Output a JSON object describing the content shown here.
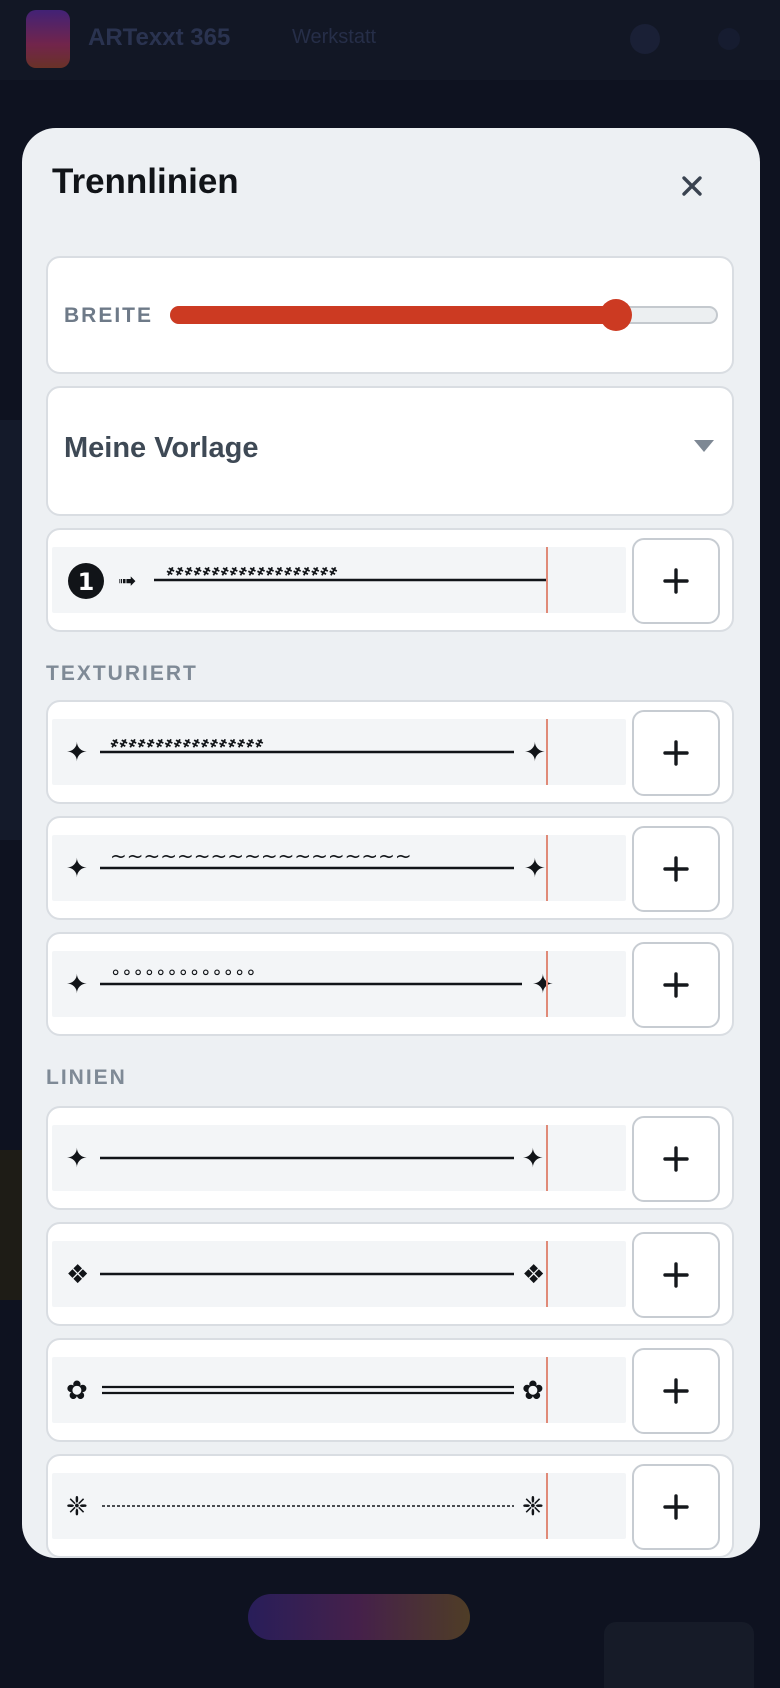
{
  "background": {
    "brand": "ARTexxt 365",
    "nav_item": "Werkstatt"
  },
  "modal": {
    "title": "Trennlinien",
    "close_icon": "close-icon"
  },
  "width_slider": {
    "label": "BREITE",
    "value_fraction": 0.81
  },
  "template_select": {
    "selected": "Meine Vorlage",
    "caret_icon": "caret-down-icon"
  },
  "template_row": {
    "start": "❶",
    "arrow": "➟",
    "texture": "҂҂҂҂҂҂҂҂҂҂҂҂҂҂҂҂҂҂҂",
    "end": ""
  },
  "sections": [
    {
      "label": "TEXTURIERT",
      "rows": [
        {
          "start": "✦",
          "texture": "҂҂҂҂҂҂҂҂҂҂҂҂҂҂҂҂҂",
          "end": "✦"
        },
        {
          "start": "✦",
          "texture": "~~~~~~~~~~~~~~~~~~",
          "end": "✦"
        },
        {
          "start": "✦",
          "texture": "∘∘∘∘∘∘∘∘∘∘∘∘∘",
          "end": "✦"
        }
      ]
    },
    {
      "label": "LINIEN",
      "rows": [
        {
          "start": "✦",
          "style": "solid",
          "end": "✦"
        },
        {
          "start": "❖",
          "style": "solid",
          "end": "❖"
        },
        {
          "start": "✿",
          "style": "double",
          "end": "✿"
        },
        {
          "start": "❈",
          "style": "dashed",
          "end": "❈"
        }
      ]
    }
  ],
  "add_icon": "plus-icon",
  "colors": {
    "accent": "#cc3a22",
    "modal_bg": "#edf0f3",
    "ink": "#111418"
  }
}
